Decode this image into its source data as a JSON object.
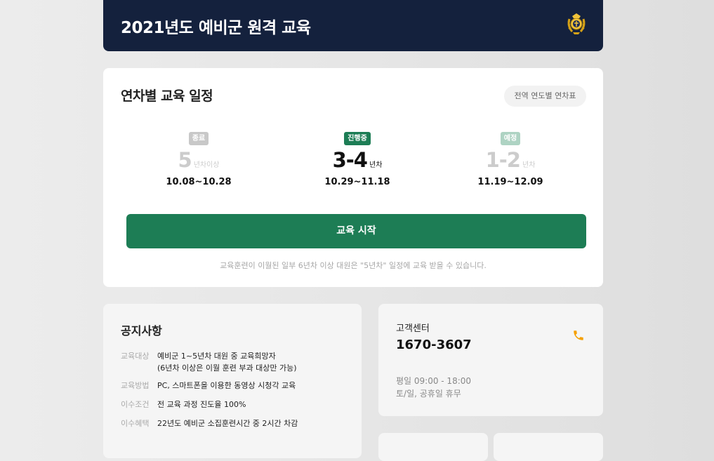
{
  "header": {
    "title": "2021년도 예비군 원격 교육",
    "emblem_icon": "reserve-forces-emblem-icon",
    "background_color": "#14213d"
  },
  "schedule": {
    "title": "연차별 교육 일정",
    "table_link_label": "전역 연도별 연차표",
    "columns": [
      {
        "status": "종료",
        "years": "5",
        "unit": "년차이상",
        "dates": "10.08~10.28"
      },
      {
        "status": "진행중",
        "years": "3-4",
        "unit": "년차",
        "dates": "10.29~11.18"
      },
      {
        "status": "예정",
        "years": "1-2",
        "unit": "년차",
        "dates": "11.19~12.09"
      }
    ],
    "start_button_label": "교육 시작",
    "note": "교육훈련이 이월된 일부 6년차 이상 대원은 \"5년차\" 일정에 교육 받을 수 있습니다.",
    "accent_color": "#1d7d55"
  },
  "notice": {
    "title": "공지사항",
    "rows": [
      {
        "key": "교육대상",
        "value_line1": "예비군 1~5년차 대원 중 교육희망자",
        "value_line2": "(6년차 이상은 이월 훈련 부과 대상만 가능)"
      },
      {
        "key": "교육방법",
        "value": "PC, 스마트폰을 이용한 동영상 시청각 교육"
      },
      {
        "key": "이수조건",
        "value": "전 교육 과정 진도율 100%"
      },
      {
        "key": "이수혜택",
        "value": "22년도 예비군 소집훈련시간 중 2시간 차감"
      }
    ]
  },
  "customer_center": {
    "title": "고객센터",
    "phone": "1670-3607",
    "phone_icon": "phone-icon",
    "hours_weekday": "평일 09:00 - 18:00",
    "hours_closed": "토/일, 공휴일 휴무",
    "icon_color": "#f5a000"
  }
}
